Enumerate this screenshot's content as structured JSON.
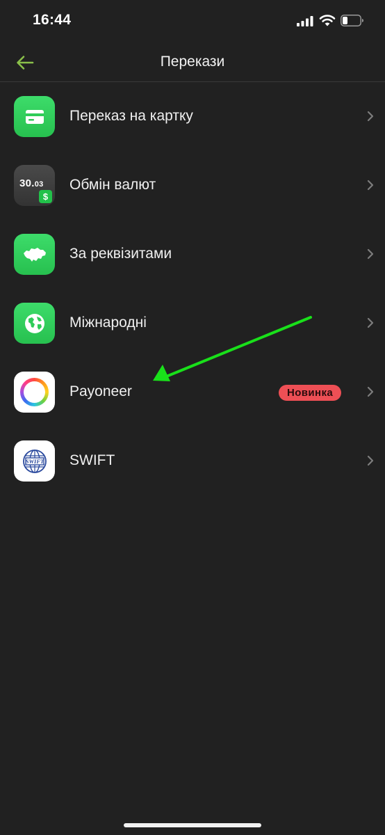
{
  "status_bar": {
    "time": "16:44"
  },
  "header": {
    "title": "Перекази"
  },
  "menu": [
    {
      "label": "Переказ на картку",
      "icon": "card-icon"
    },
    {
      "label": "Обмін валют",
      "icon": "currency-rate-icon",
      "rate_main": "30.",
      "rate_small": "03",
      "currency_symbol": "$"
    },
    {
      "label": "За реквізитами",
      "icon": "ukraine-map-icon"
    },
    {
      "label": "Міжнародні",
      "icon": "globe-icon"
    },
    {
      "label": "Payoneer",
      "icon": "payoneer-ring-icon",
      "badge": "Новинка"
    },
    {
      "label": "SWIFT",
      "icon": "swift-logo-icon",
      "logo_text": "SWIFT"
    }
  ],
  "colors": {
    "background": "#212121",
    "accent_green": "#8ac04a",
    "badge_red": "#ee4f55",
    "annotation_arrow": "#19e01a"
  }
}
